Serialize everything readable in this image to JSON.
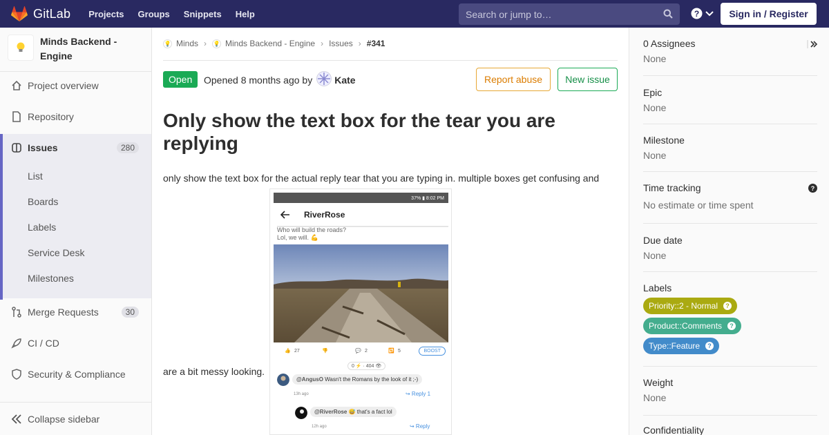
{
  "topnav": {
    "brand": "GitLab",
    "links": [
      "Projects",
      "Groups",
      "Snippets",
      "Help"
    ],
    "search_placeholder": "Search or jump to…",
    "signin": "Sign in / Register",
    "icons": [
      "gitlab-tanuki-icon",
      "search-icon",
      "help-icon",
      "chevron-down-icon"
    ]
  },
  "sidebar": {
    "project_name": "Minds Backend - Engine",
    "items": [
      {
        "label": "Project overview",
        "icon": "home-icon"
      },
      {
        "label": "Repository",
        "icon": "document-icon"
      },
      {
        "label": "Issues",
        "icon": "issues-icon",
        "count": "280"
      },
      {
        "label": "Merge Requests",
        "icon": "merge-request-icon",
        "count": "30"
      },
      {
        "label": "CI / CD",
        "icon": "rocket-icon"
      },
      {
        "label": "Security & Compliance",
        "icon": "shield-icon"
      }
    ],
    "issues_sub": [
      "List",
      "Boards",
      "Labels",
      "Service Desk",
      "Milestones"
    ],
    "collapse": "Collapse sidebar"
  },
  "main": {
    "breadcrumb": [
      "Minds",
      "Minds Backend - Engine",
      "Issues",
      "#341"
    ],
    "status": "Open",
    "opened_text": "Opened 8 months ago by",
    "author": "Kate",
    "report_abuse": "Report abuse",
    "new_issue": "New issue",
    "title": "Only show the text box for the tear you are replying",
    "desc_line1": "only show the text box for the actual reply tear that you are typing in. multiple boxes get confusing and",
    "desc_line2": "are a bit messy looking."
  },
  "screenshot": {
    "status_bar": "37% ▮ 8:02 PM",
    "channel": "RiverRose",
    "caption_line1": "Who will build the roads?",
    "caption_line2": "Lol, we will. 💪",
    "votes_up": "27",
    "comments": "2",
    "reminds": "5",
    "boost": "BOOST",
    "stats": "0 ⚡ · 404 👁",
    "comment1_user": "@AngusO",
    "comment1_text": "Wasn't the Romans by the look of it ;-)",
    "comment1_time": "13h ago",
    "comment1_reply": "↪ Reply 1",
    "comment2_user": "@RiverRose",
    "comment2_text": "😅 that's a fact lol",
    "comment2_time": "12h ago",
    "comment2_reply": "↪ Reply"
  },
  "right": {
    "assignees_title": "0 Assignees",
    "assignees_value": "None",
    "epic_title": "Epic",
    "epic_value": "None",
    "milestone_title": "Milestone",
    "milestone_value": "None",
    "time_title": "Time tracking",
    "time_value": "No estimate or time spent",
    "due_title": "Due date",
    "due_value": "None",
    "labels_title": "Labels",
    "labels": [
      {
        "text": "Priority::2 - Normal",
        "color": "#aaaa11"
      },
      {
        "text": "Product::Comments",
        "color": "#44ad8e"
      },
      {
        "text": "Type::Feature",
        "color": "#428bca"
      }
    ],
    "weight_title": "Weight",
    "weight_value": "None",
    "confidentiality_title": "Confidentiality"
  },
  "colors": {
    "nav_bg": "#292961",
    "accent": "#6666c4",
    "open_green": "#1aaa55",
    "abuse_orange": "#db7c00"
  }
}
